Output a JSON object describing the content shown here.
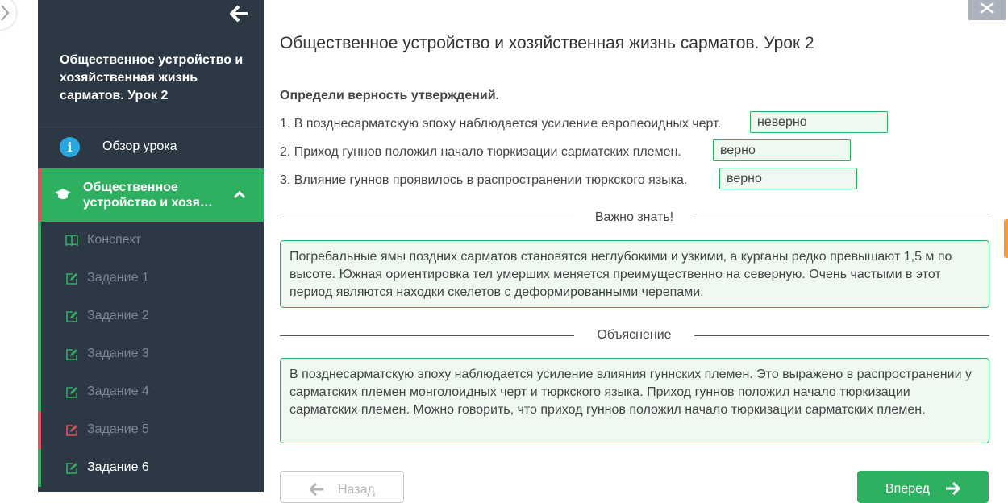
{
  "sidebar": {
    "lesson_title": "Общественное устройство и хозяйственная жизнь сарматов. Урок 2",
    "overview_label": "Обзор урока",
    "section_label": "Общественное устройство и хозя…",
    "items": [
      {
        "label": "Конспект",
        "icon": "book-icon",
        "status": "done"
      },
      {
        "label": "Задание 1",
        "icon": "edit-icon",
        "status": "correct"
      },
      {
        "label": "Задание 2",
        "icon": "edit-icon",
        "status": "correct"
      },
      {
        "label": "Задание 3",
        "icon": "edit-icon",
        "status": "correct"
      },
      {
        "label": "Задание 4",
        "icon": "edit-icon",
        "status": "correct"
      },
      {
        "label": "Задание 5",
        "icon": "edit-icon",
        "status": "wrong"
      },
      {
        "label": "Задание 6",
        "icon": "edit-icon",
        "status": "current"
      }
    ]
  },
  "main": {
    "title": "Общественное устройство и хозяйственная жизнь сарматов. Урок 2",
    "task_heading": "Определи верность утверждений.",
    "statements": [
      {
        "text": "1. В позднесарматскую эпоху наблюдается усиление европеоидных черт.",
        "answer": "неверно"
      },
      {
        "text": "2. Приход гуннов положил начало тюркизации сарматских племен.",
        "answer": "верно"
      },
      {
        "text": "3. Влияние гуннов проявилось в распространении тюркского языка.",
        "answer": "верно"
      }
    ],
    "important_heading": "Важно знать!",
    "important_text": "Погребальные ямы поздних сарматов становятся неглубокими и узкими, а курганы редко превышают 1,5 м по высоте. Южная ориентировка тел умерших меняется преимущественно на северную. Очень частыми в этот период являются находки скелетов с деформированными черепами.",
    "explanation_heading": "Объяснение",
    "explanation_text": "В позднесарматскую эпоху наблюдается усиление влияния гуннских племен. Это выражено в распространении у сарматских племен монголоидных черт и тюркского языка. Приход гуннов положил начало тюркизации сарматских племен. Можно говорить, что приход гуннов положил начало тюркизации сарматских племен.",
    "back_label": "Назад",
    "next_label": "Вперед"
  },
  "colors": {
    "sidebar_bg": "#2d3845",
    "accent_green": "#2db160",
    "error_red": "#e0525b",
    "info_blue": "#29a8e0",
    "answer_bg": "#eef9f2"
  }
}
